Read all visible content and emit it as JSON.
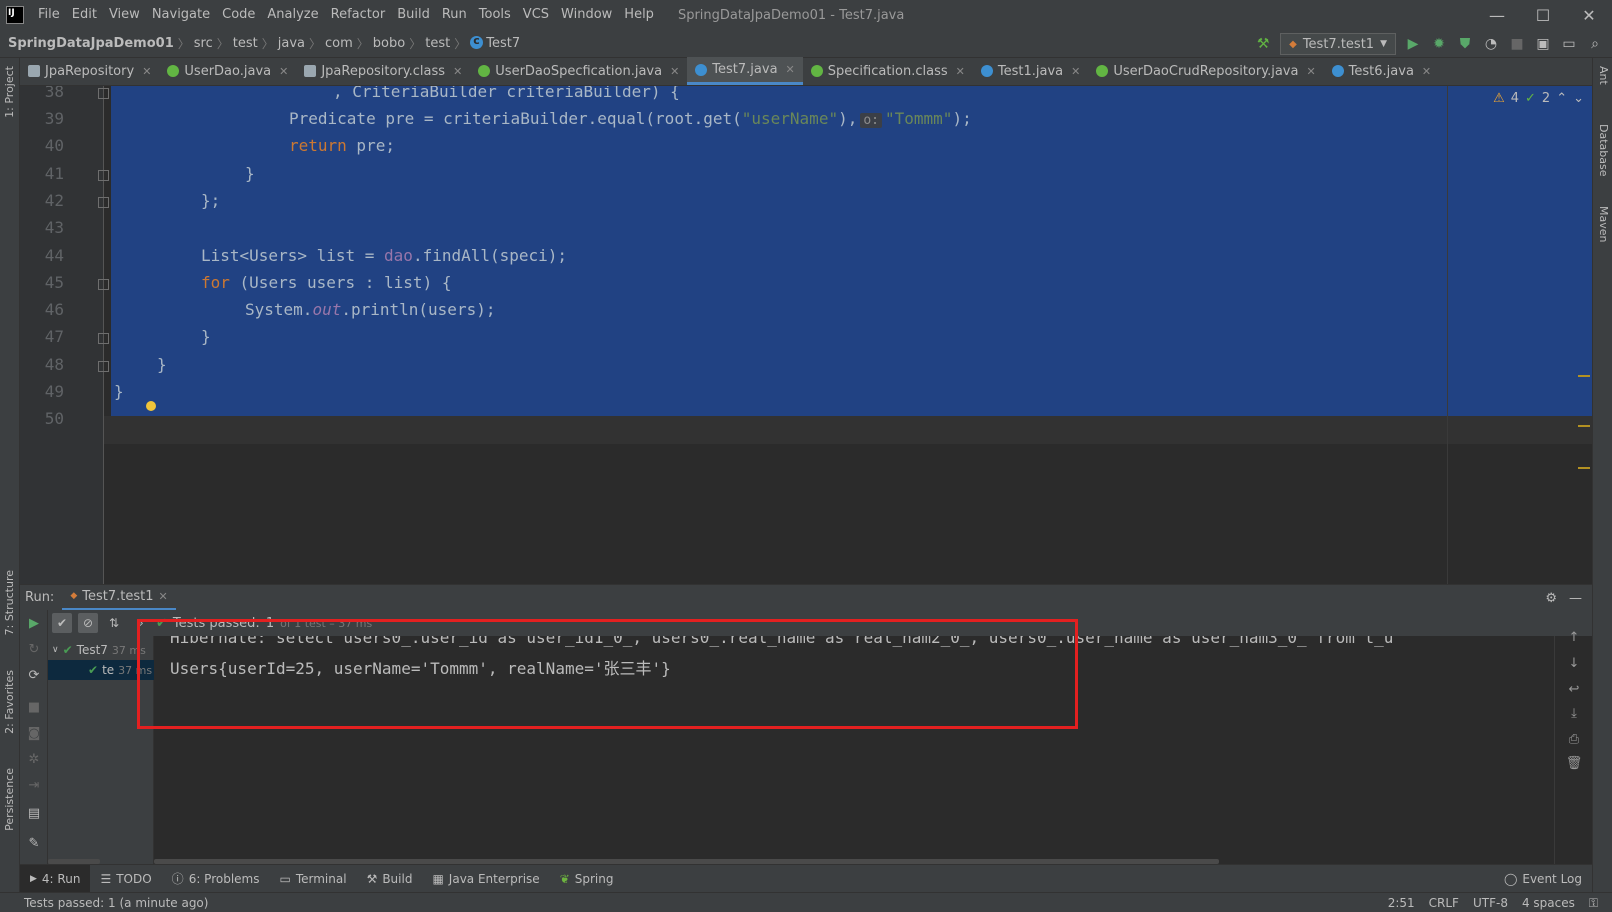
{
  "window": {
    "title": "SpringDataJpaDemo01 - Test7.java",
    "minimize": "—",
    "maximize": "☐",
    "close": "✕"
  },
  "menu": [
    "File",
    "Edit",
    "View",
    "Navigate",
    "Code",
    "Analyze",
    "Refactor",
    "Build",
    "Run",
    "Tools",
    "VCS",
    "Window",
    "Help"
  ],
  "breadcrumb": [
    "SpringDataJpaDemo01",
    "src",
    "test",
    "java",
    "com",
    "bobo",
    "test",
    "Test7"
  ],
  "toolbar": {
    "run_config": "Test7.test1"
  },
  "tabs": [
    {
      "label": "JpaRepository",
      "icon": "jar"
    },
    {
      "label": "UserDao.java",
      "icon": "i"
    },
    {
      "label": "JpaRepository.class",
      "icon": "jar"
    },
    {
      "label": "UserDaoSpecfication.java",
      "icon": "i"
    },
    {
      "label": "Test7.java",
      "icon": "c"
    },
    {
      "label": "Specification.class",
      "icon": "i"
    },
    {
      "label": "Test1.java",
      "icon": "c"
    },
    {
      "label": "UserDaoCrudRepository.java",
      "icon": "i"
    },
    {
      "label": "Test6.java",
      "icon": "c"
    }
  ],
  "inspection": {
    "warnings": "4",
    "weak_warnings": "2"
  },
  "editor": {
    "line_numbers": [
      "38",
      "39",
      "40",
      "41",
      "42",
      "43",
      "44",
      "45",
      "46",
      "47",
      "48",
      "49",
      "50"
    ],
    "code": {
      "l38": ", CriteriaBuilder criteriaBuilder) {",
      "l39a": "Predicate pre = criteriaBuilder.equal(root.get(",
      "l39b": "\"userName\"",
      "l39c": "),",
      "l39hint": "o:",
      "l39d": "\"Tommm\"",
      "l39e": ");",
      "l40a": "return",
      "l40b": " pre;",
      "l41": "}",
      "l42": "};",
      "l44a": "List<Users> list = ",
      "l44b": "dao",
      "l44c": ".findAll(speci);",
      "l45a": "for",
      "l45b": " (Users users : list) {",
      "l46a": "System.",
      "l46b": "out",
      "l46c": ".println(users);",
      "l47": "}",
      "l48": "}",
      "l49": "}"
    }
  },
  "run": {
    "label": "Run:",
    "tab": "Test7.test1",
    "status": "Tests passed:",
    "passed_count": "1",
    "status_detail": "of 1 test – 37 ms",
    "tree": [
      {
        "label": "Test7",
        "time": "37 ms"
      },
      {
        "label": "te",
        "time": "37 ms"
      }
    ],
    "console": [
      "Hibernate: select users0_.user_id as user_id1_0_, users0_.real_name as real_nam2_0_, users0_.user_name as user_nam3_0_ from t_u",
      "Users{userId=25, userName='Tommm', realName='张三丰'}"
    ]
  },
  "left_strip": [
    "1: Project",
    "7: Structure",
    "2: Favorites",
    "Persistence"
  ],
  "right_strip": [
    "Ant",
    "Database",
    "Maven"
  ],
  "bottom_tools": [
    {
      "label": "4: Run",
      "icon": "play-icon"
    },
    {
      "label": "TODO",
      "icon": "list-icon"
    },
    {
      "label": "6: Problems",
      "icon": "info-icon"
    },
    {
      "label": "Terminal",
      "icon": "terminal-icon"
    },
    {
      "label": "Build",
      "icon": "hammer-icon"
    },
    {
      "label": "Java Enterprise",
      "icon": "enterprise-icon"
    },
    {
      "label": "Spring",
      "icon": "spring-icon"
    }
  ],
  "event_log": "Event Log",
  "status": {
    "message": "Tests passed: 1 (a minute ago)",
    "position": "2:51",
    "line_sep": "CRLF",
    "encoding": "UTF-8",
    "indent": "4 spaces"
  }
}
